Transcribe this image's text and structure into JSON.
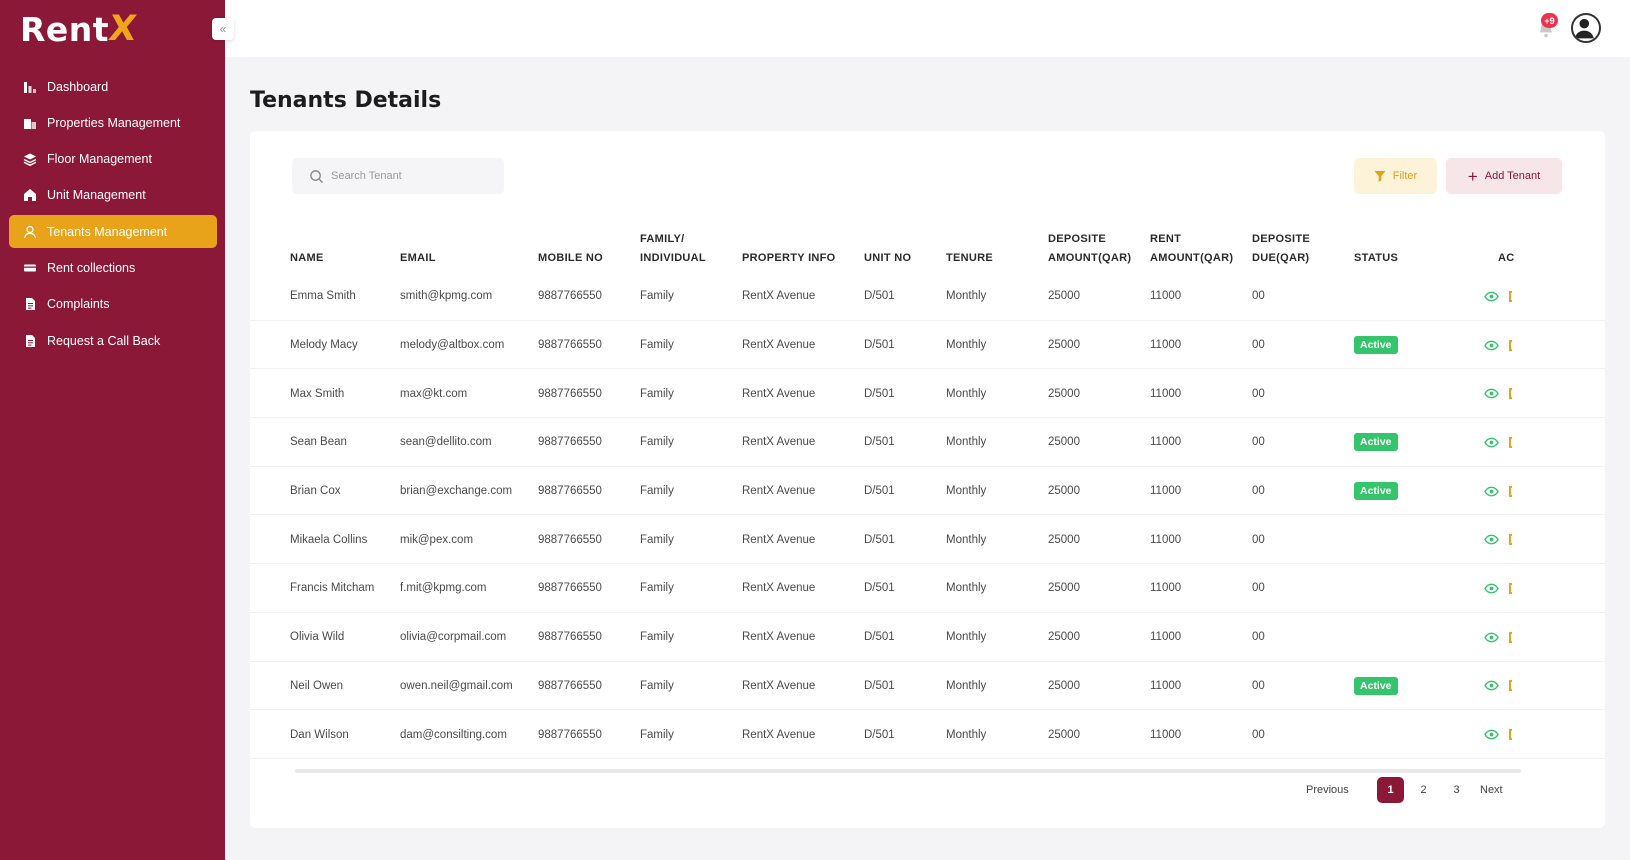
{
  "app": {
    "logo_text": "Rent",
    "logo_accent": "X",
    "brand_color": "#8c1838",
    "accent_color": "#e8a31a"
  },
  "sidebar": {
    "collapse_icon": "chevrons-left-icon",
    "items": [
      {
        "label": "Dashboard",
        "icon": "dashboard-icon",
        "active": false
      },
      {
        "label": "Properties Management",
        "icon": "building-icon",
        "active": false
      },
      {
        "label": "Floor Management",
        "icon": "layers-icon",
        "active": false
      },
      {
        "label": "Unit Management",
        "icon": "home-icon",
        "active": false
      },
      {
        "label": "Tenants Management",
        "icon": "user-icon",
        "active": true
      },
      {
        "label": "Rent collections",
        "icon": "card-icon",
        "active": false
      },
      {
        "label": "Complaints",
        "icon": "document-icon",
        "active": false
      },
      {
        "label": "Request a Call Back",
        "icon": "document-icon",
        "active": false
      }
    ]
  },
  "header": {
    "notification_count": "+9",
    "notification_icon": "bell-icon",
    "avatar_icon": "user-avatar-icon"
  },
  "page": {
    "title": "Tenants Details"
  },
  "toolbar": {
    "search_placeholder": "Search Tenant",
    "filter_label": "Filter",
    "add_label": "Add Tenant"
  },
  "table": {
    "columns": [
      {
        "line1": "",
        "line2": "NAME"
      },
      {
        "line1": "",
        "line2": "EMAIL"
      },
      {
        "line1": "",
        "line2": "MOBILE NO"
      },
      {
        "line1": "FAMILY/",
        "line2": "INDIVIDUAL"
      },
      {
        "line1": "",
        "line2": "PROPERTY INFO"
      },
      {
        "line1": "",
        "line2": "UNIT NO"
      },
      {
        "line1": "",
        "line2": "TENURE"
      },
      {
        "line1": "DEPOSITE",
        "line2": "AMOUNT(QAR)"
      },
      {
        "line1": "RENT",
        "line2": "AMOUNT(QAR)"
      },
      {
        "line1": "DEPOSITE",
        "line2": "DUE(QAR)"
      },
      {
        "line1": "",
        "line2": "STATUS"
      },
      {
        "line1": "",
        "line2": "AC"
      }
    ],
    "rows": [
      {
        "name": "Emma Smith",
        "email": "smith@kpmg.com",
        "mobile": "9887766550",
        "type": "Family",
        "property": "RentX Avenue",
        "unit": "D/501",
        "tenure": "Monthly",
        "deposit": "25000",
        "rent": "11000",
        "due": "00",
        "status": ""
      },
      {
        "name": "Melody Macy",
        "email": "melody@altbox.com",
        "mobile": "9887766550",
        "type": "Family",
        "property": "RentX Avenue",
        "unit": "D/501",
        "tenure": "Monthly",
        "deposit": "25000",
        "rent": "11000",
        "due": "00",
        "status": "Active"
      },
      {
        "name": "Max Smith",
        "email": "max@kt.com",
        "mobile": "9887766550",
        "type": "Family",
        "property": "RentX Avenue",
        "unit": "D/501",
        "tenure": "Monthly",
        "deposit": "25000",
        "rent": "11000",
        "due": "00",
        "status": ""
      },
      {
        "name": "Sean Bean",
        "email": "sean@dellito.com",
        "mobile": "9887766550",
        "type": "Family",
        "property": "RentX Avenue",
        "unit": "D/501",
        "tenure": "Monthly",
        "deposit": "25000",
        "rent": "11000",
        "due": "00",
        "status": "Active"
      },
      {
        "name": "Brian Cox",
        "email": "brian@exchange.com",
        "mobile": "9887766550",
        "type": "Family",
        "property": "RentX Avenue",
        "unit": "D/501",
        "tenure": "Monthly",
        "deposit": "25000",
        "rent": "11000",
        "due": "00",
        "status": "Active"
      },
      {
        "name": "Mikaela Collins",
        "email": "mik@pex.com",
        "mobile": "9887766550",
        "type": "Family",
        "property": "RentX Avenue",
        "unit": "D/501",
        "tenure": "Monthly",
        "deposit": "25000",
        "rent": "11000",
        "due": "00",
        "status": ""
      },
      {
        "name": "Francis Mitcham",
        "email": "f.mit@kpmg.com",
        "mobile": "9887766550",
        "type": "Family",
        "property": "RentX Avenue",
        "unit": "D/501",
        "tenure": "Monthly",
        "deposit": "25000",
        "rent": "11000",
        "due": "00",
        "status": ""
      },
      {
        "name": "Olivia Wild",
        "email": "olivia@corpmail.com",
        "mobile": "9887766550",
        "type": "Family",
        "property": "RentX Avenue",
        "unit": "D/501",
        "tenure": "Monthly",
        "deposit": "25000",
        "rent": "11000",
        "due": "00",
        "status": ""
      },
      {
        "name": "Neil Owen",
        "email": "owen.neil@gmail.com",
        "mobile": "9887766550",
        "type": "Family",
        "property": "RentX Avenue",
        "unit": "D/501",
        "tenure": "Monthly",
        "deposit": "25000",
        "rent": "11000",
        "due": "00",
        "status": "Active"
      },
      {
        "name": "Dan Wilson",
        "email": "dam@consilting.com",
        "mobile": "9887766550",
        "type": "Family",
        "property": "RentX Avenue",
        "unit": "D/501",
        "tenure": "Monthly",
        "deposit": "25000",
        "rent": "11000",
        "due": "00",
        "status": ""
      }
    ],
    "row_action_icon": "eye-icon"
  },
  "pagination": {
    "previous": "Previous",
    "pages": [
      "1",
      "2",
      "3"
    ],
    "current": "1",
    "next": "Next"
  }
}
